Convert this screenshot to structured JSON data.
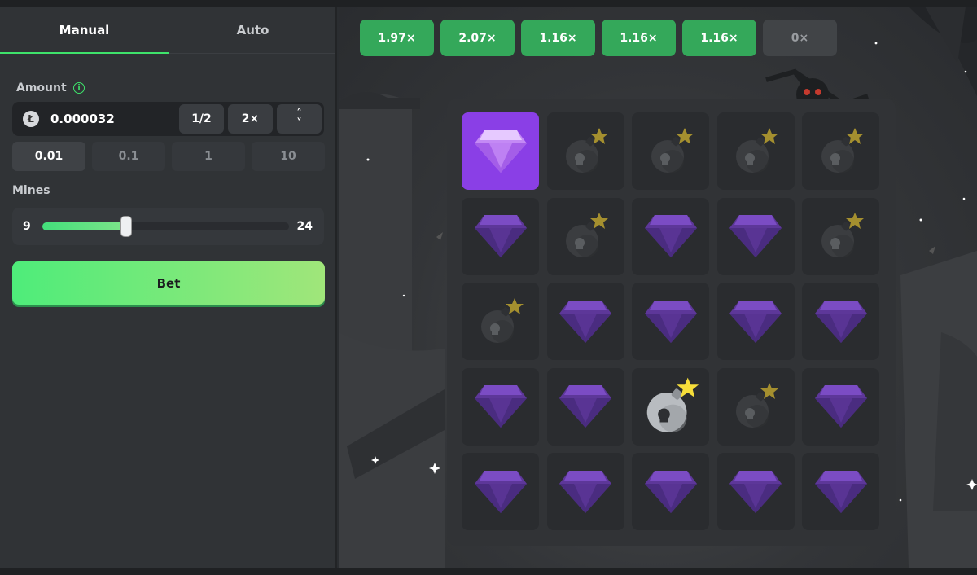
{
  "tabs": {
    "manual": "Manual",
    "auto": "Auto"
  },
  "amount": {
    "label": "Amount",
    "info_icon": "i",
    "coin_icon": "Ł",
    "value": "0.000032",
    "half_label": "1/2",
    "double_label": "2×",
    "up_symbol": "˄",
    "down_symbol": "˅"
  },
  "quick_amounts": [
    "0.01",
    "0.1",
    "1",
    "10"
  ],
  "mines": {
    "label": "Mines",
    "min": "9",
    "max": "24",
    "fill_fraction": 0.34
  },
  "bet_label": "Bet",
  "multipliers": [
    {
      "label": "1.97×",
      "active": true
    },
    {
      "label": "2.07×",
      "active": true
    },
    {
      "label": "1.16×",
      "active": true
    },
    {
      "label": "1.16×",
      "active": true
    },
    {
      "label": "1.16×",
      "active": true
    },
    {
      "label": "0×",
      "active": false
    }
  ],
  "board": [
    [
      "gem-revealed",
      "bomb",
      "bomb",
      "bomb",
      "bomb"
    ],
    [
      "gem",
      "bomb",
      "gem",
      "gem",
      "bomb"
    ],
    [
      "bomb",
      "gem",
      "gem",
      "gem",
      "gem"
    ],
    [
      "gem",
      "gem",
      "bomb-hit",
      "bomb",
      "gem"
    ],
    [
      "gem",
      "gem",
      "gem",
      "gem",
      "gem"
    ]
  ],
  "colors": {
    "accent_green": "#3ee36b",
    "multiplier_green": "#34a85a",
    "gem_purple": "#6b3fb0",
    "revealed_purple": "#8a3fe6",
    "bomb_star": "#f2d33b"
  }
}
